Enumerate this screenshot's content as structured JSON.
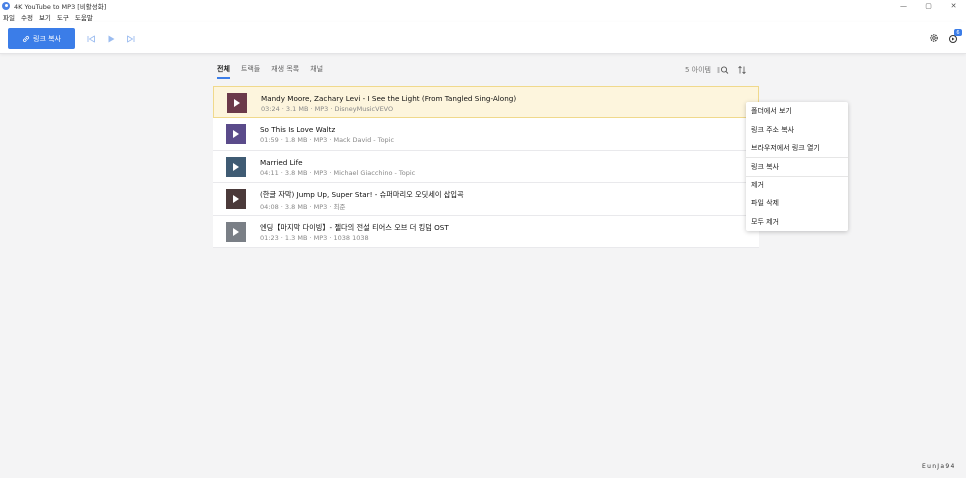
{
  "window": {
    "title": "4K YouTube to MP3 [비활성화]",
    "controls": {
      "minimize": "—",
      "maximize": "▢",
      "close": "✕"
    }
  },
  "menu": [
    "파일",
    "수정",
    "보기",
    "도구",
    "도움말"
  ],
  "toolbar": {
    "paste_label": "링크 복사",
    "accent": "#3b7de8",
    "icons": [
      "link-icon",
      "skip-back-icon",
      "play-icon",
      "skip-forward-icon",
      "gear-icon",
      "subscriptions-icon"
    ],
    "subscription_badge": "6"
  },
  "tabs": [
    {
      "label": "전체",
      "active": true
    },
    {
      "label": "트랙들",
      "active": false
    },
    {
      "label": "재생 목록",
      "active": false
    },
    {
      "label": "채널",
      "active": false
    }
  ],
  "list_tools": {
    "count": "5 아이템",
    "icons": [
      "search-icon",
      "sort-icon"
    ]
  },
  "items": [
    {
      "title": "Mandy Moore, Zachary Levi - I See the Light (From  Tangled Sing-Along)",
      "meta": "03:24 · 3.1 MB · MP3 · DisneyMusicVEVO",
      "selected": true,
      "thumb_color": "#6b3a4a"
    },
    {
      "title": "So This Is Love Waltz",
      "meta": "01:59 · 1.8 MB · MP3 · Mack David - Topic",
      "selected": false,
      "thumb_color": "#5a4b8a"
    },
    {
      "title": "Married Life",
      "meta": "04:11 · 3.8 MB · MP3 · Michael Giacchino - Topic",
      "selected": false,
      "thumb_color": "#3f5b73"
    },
    {
      "title": "(한글 자막) Jump Up, Super Star! - 슈퍼마리오 오딧세이 삽입곡",
      "meta": "04:08 · 3.8 MB · MP3 · 최준",
      "selected": false,
      "thumb_color": "#4b3a3a"
    },
    {
      "title": "엔딩【마지막 다이빙】- 젤다의 전설  티어스 오브 더 킹덤 OST",
      "meta": "01:23 · 1.3 MB · MP3 · 1038 1038",
      "selected": false,
      "thumb_color": "#7a7f86"
    }
  ],
  "context_menu": [
    {
      "label": "폴더에서 보기",
      "sep": false
    },
    {
      "label": "링크 주소 복사",
      "sep": false
    },
    {
      "label": "브라우저에서 링크 열기",
      "sep": false
    },
    {
      "label": "링크 복사",
      "sep": true
    },
    {
      "label": "제거",
      "sep": true
    },
    {
      "label": "파일 삭제",
      "sep": false
    },
    {
      "label": "모두 제거",
      "sep": false
    }
  ],
  "watermark": "EunJa94"
}
